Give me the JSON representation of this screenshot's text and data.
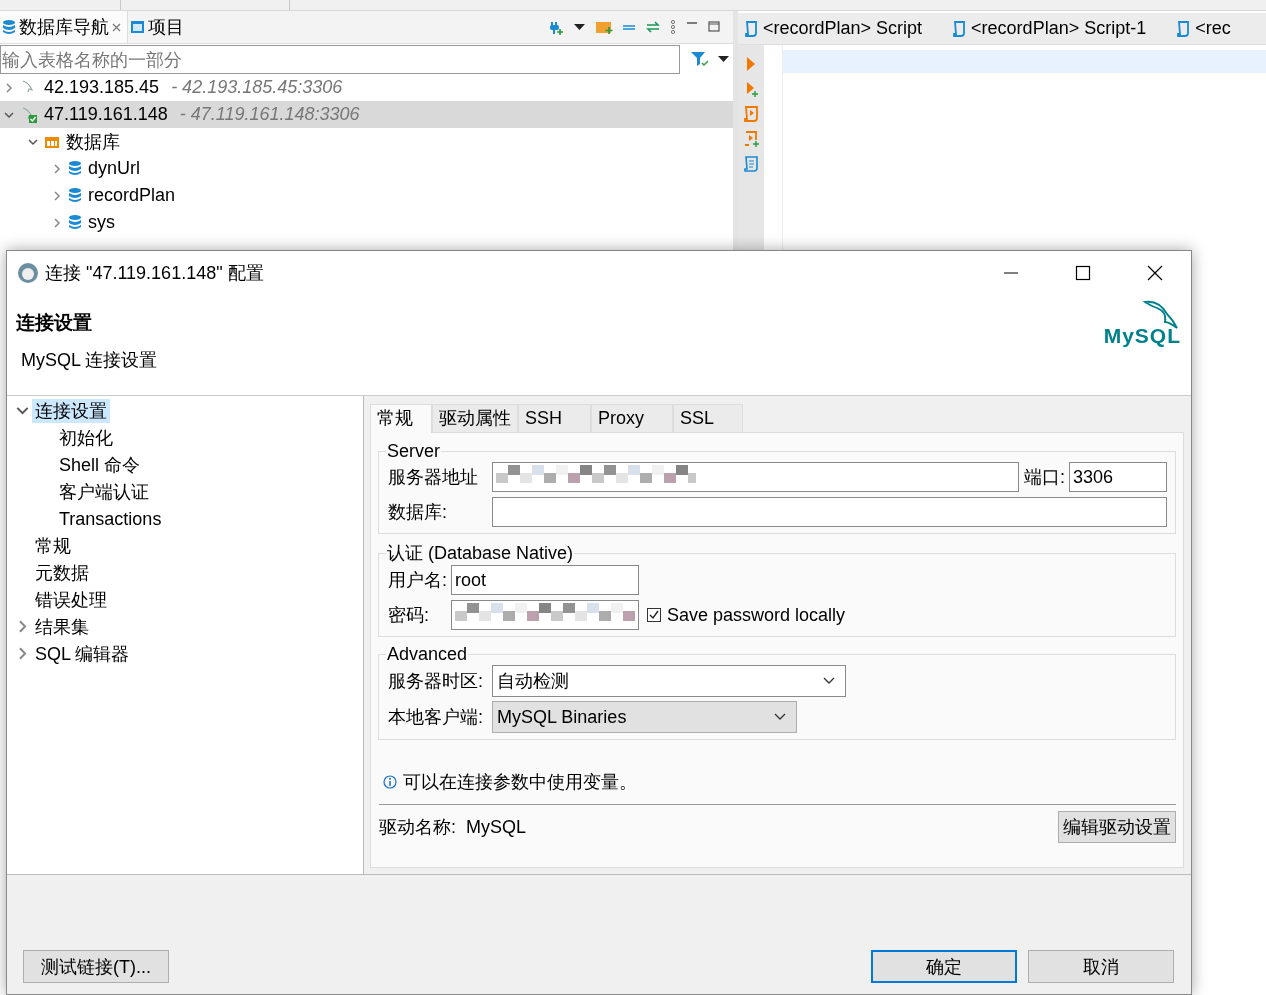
{
  "navigator": {
    "tabs": [
      {
        "label": "数据库导航",
        "selected": true,
        "closable": true
      },
      {
        "label": "项目",
        "selected": false,
        "closable": false
      }
    ],
    "filter": {
      "placeholder": "输入表格名称的一部分"
    },
    "tree": [
      {
        "name": "42.193.185.45",
        "detail": "- 42.193.185.45:3306",
        "kind": "connection",
        "connected": false,
        "expanded": false,
        "selected": false
      },
      {
        "name": "47.119.161.148",
        "detail": "- 47.119.161.148:3306",
        "kind": "connection",
        "connected": true,
        "expanded": true,
        "selected": true,
        "children": [
          {
            "name": "数据库",
            "kind": "folder",
            "expanded": true,
            "selected": false,
            "children": [
              {
                "name": "dynUrl",
                "kind": "database",
                "expanded": false,
                "selected": false
              },
              {
                "name": "recordPlan",
                "kind": "database",
                "expanded": false,
                "selected": false
              },
              {
                "name": "sys",
                "kind": "database",
                "expanded": false,
                "selected": false
              }
            ]
          }
        ]
      }
    ]
  },
  "editor": {
    "tabs": [
      {
        "label": "<recordPlan> Script"
      },
      {
        "label": "<recordPlan> Script-1"
      },
      {
        "label": "<rec"
      }
    ]
  },
  "dialog": {
    "title": "连接 \"47.119.161.148\" 配置",
    "header": {
      "title": "连接设置",
      "subtitle": "MySQL 连接设置",
      "logo_text": "MySQL"
    },
    "nav": [
      {
        "label": "连接设置",
        "kind": "group",
        "expanded": true,
        "selected": true,
        "children": [
          {
            "label": "初始化",
            "kind": "leaf",
            "selected": false
          },
          {
            "label": "Shell 命令",
            "kind": "leaf",
            "selected": false
          },
          {
            "label": "客户端认证",
            "kind": "leaf",
            "selected": false
          },
          {
            "label": "Transactions",
            "kind": "leaf",
            "selected": false
          }
        ]
      },
      {
        "label": "常规",
        "kind": "leaf",
        "selected": false
      },
      {
        "label": "元数据",
        "kind": "leaf",
        "selected": false
      },
      {
        "label": "错误处理",
        "kind": "leaf",
        "selected": false
      },
      {
        "label": "结果集",
        "kind": "group",
        "expanded": false,
        "selected": false
      },
      {
        "label": "SQL 编辑器",
        "kind": "group",
        "expanded": false,
        "selected": false
      }
    ],
    "tabs": [
      {
        "label": "常规",
        "selected": true
      },
      {
        "label": "驱动属性",
        "selected": false
      },
      {
        "label": "SSH",
        "selected": false
      },
      {
        "label": "Proxy",
        "selected": false
      },
      {
        "label": "SSL",
        "selected": false
      }
    ],
    "server": {
      "title": "Server",
      "host_label": "服务器地址",
      "port_label": "端口:",
      "port": "3306",
      "database_label": "数据库:"
    },
    "auth": {
      "title": "认证 (Database Native)",
      "user_label": "用户名:",
      "user": "root",
      "password_label": "密码:",
      "save_password": {
        "label": "Save password locally",
        "checked": true
      }
    },
    "advanced": {
      "title": "Advanced",
      "combos": [
        {
          "label": "服务器时区:",
          "value": "自动检测",
          "kind": "editable"
        },
        {
          "label": "本地客户端:",
          "value": "MySQL Binaries",
          "kind": "readonly"
        }
      ]
    },
    "info": "可以在连接参数中使用变量。",
    "driver": {
      "label": "驱动名称:",
      "name": "MySQL",
      "button": "编辑驱动设置"
    },
    "buttons": [
      {
        "label": "测试链接(T)...",
        "kind": "test",
        "default": false
      },
      {
        "label": "确定",
        "kind": "ok",
        "default": true
      },
      {
        "label": "取消",
        "kind": "cancel",
        "default": false
      }
    ]
  }
}
